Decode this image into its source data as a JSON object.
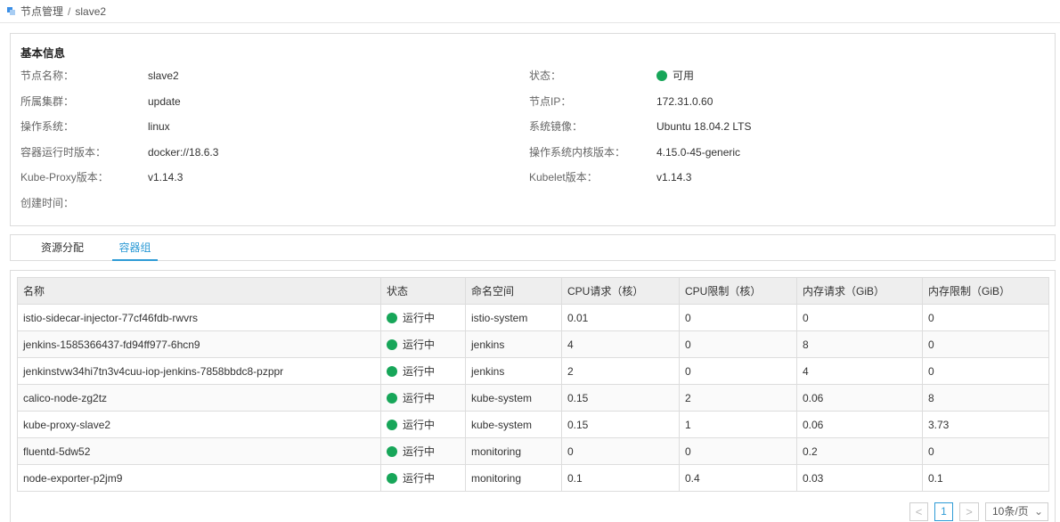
{
  "breadcrumb": {
    "section": "节点管理",
    "separator": "/",
    "current": "slave2"
  },
  "info": {
    "title": "基本信息",
    "left": [
      {
        "label": "节点名称：",
        "value": "slave2"
      },
      {
        "label": "所属集群：",
        "value": "update"
      },
      {
        "label": "操作系统：",
        "value": "linux"
      },
      {
        "label": "容器运行时版本：",
        "value": "docker://18.6.3"
      },
      {
        "label": "Kube-Proxy版本：",
        "value": "v1.14.3"
      },
      {
        "label": "创建时间：",
        "value": ""
      }
    ],
    "right": [
      {
        "label": "状态：",
        "value": "可用"
      },
      {
        "label": "节点IP：",
        "value": "172.31.0.60"
      },
      {
        "label": "系统镜像：",
        "value": "Ubuntu 18.04.2 LTS"
      },
      {
        "label": "操作系统内核版本：",
        "value": "4.15.0-45-generic"
      },
      {
        "label": "Kubelet版本：",
        "value": "v1.14.3"
      }
    ],
    "status_color": "#17a659"
  },
  "tabs": [
    {
      "label": "资源分配",
      "active": false
    },
    {
      "label": "容器组",
      "active": true
    }
  ],
  "table": {
    "columns": [
      "名称",
      "状态",
      "命名空间",
      "CPU请求（核）",
      "CPU限制（核）",
      "内存请求（GiB）",
      "内存限制（GiB）"
    ],
    "rows": [
      [
        "istio-sidecar-injector-77cf46fdb-rwvrs",
        "运行中",
        "istio-system",
        "0.01",
        "0",
        "0",
        "0"
      ],
      [
        "jenkins-1585366437-fd94ff977-6hcn9",
        "运行中",
        "jenkins",
        "4",
        "0",
        "8",
        "0"
      ],
      [
        "jenkinstvw34hi7tn3v4cuu-iop-jenkins-7858bbdc8-pzppr",
        "运行中",
        "jenkins",
        "2",
        "0",
        "4",
        "0"
      ],
      [
        "calico-node-zg2tz",
        "运行中",
        "kube-system",
        "0.15",
        "2",
        "0.06",
        "8"
      ],
      [
        "kube-proxy-slave2",
        "运行中",
        "kube-system",
        "0.15",
        "1",
        "0.06",
        "3.73"
      ],
      [
        "fluentd-5dw52",
        "运行中",
        "monitoring",
        "0",
        "0",
        "0.2",
        "0"
      ],
      [
        "node-exporter-p2jm9",
        "运行中",
        "monitoring",
        "0.1",
        "0.4",
        "0.03",
        "0.1"
      ]
    ]
  },
  "pagination": {
    "prev": "<",
    "page": "1",
    "next": ">",
    "page_size": "10条/页"
  }
}
